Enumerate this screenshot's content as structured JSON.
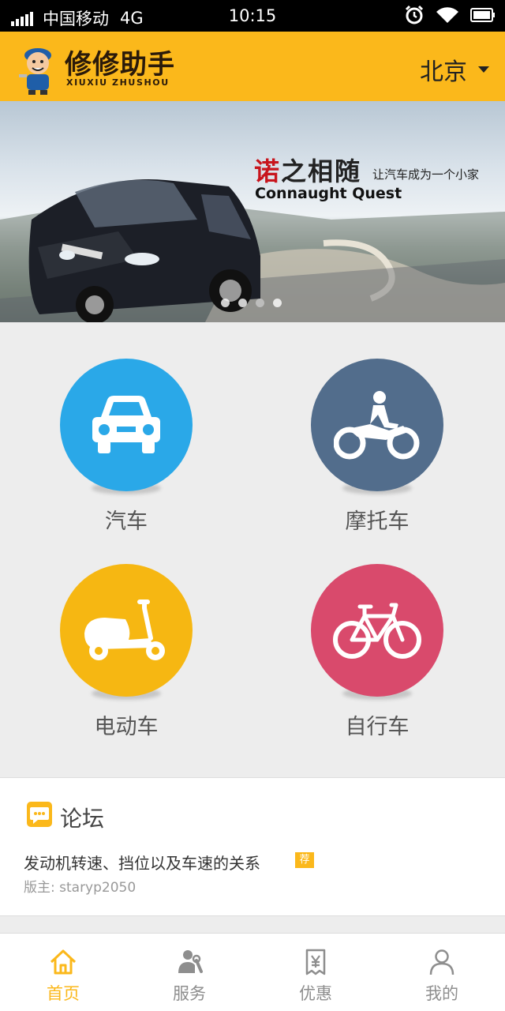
{
  "status_bar": {
    "carrier": "中国移动",
    "network": "4G",
    "time": "10:15"
  },
  "header": {
    "brand_title": "修修助手",
    "brand_subtitle": "XIUXIU ZHUSHOU",
    "city": "北京"
  },
  "banner": {
    "headline_red": "诺",
    "headline_rest": "之相随",
    "tagline": "让汽车成为一个小家",
    "english": "Connaught Quest",
    "slide_count": 4,
    "active_slide": 1
  },
  "categories": [
    {
      "label": "汽车",
      "icon": "car-icon",
      "color": "#2aa8e8"
    },
    {
      "label": "摩托车",
      "icon": "motorcycle-icon",
      "color": "#526d8c"
    },
    {
      "label": "电动车",
      "icon": "scooter-icon",
      "color": "#f6b712"
    },
    {
      "label": "自行车",
      "icon": "bicycle-icon",
      "color": "#d94a6c"
    }
  ],
  "forum": {
    "title": "论坛",
    "post": {
      "title": "发动机转速、挡位以及车速的关系",
      "badge": "荐",
      "author": "版主: staryp2050"
    }
  },
  "nav": [
    {
      "label": "首页",
      "icon": "home-icon",
      "active": true
    },
    {
      "label": "服务",
      "icon": "mechanic-icon",
      "active": false
    },
    {
      "label": "优惠",
      "icon": "coupon-icon",
      "active": false
    },
    {
      "label": "我的",
      "icon": "profile-icon",
      "active": false
    }
  ],
  "colors": {
    "accent": "#fbb81b",
    "nav_inactive": "#8e8e8e"
  }
}
